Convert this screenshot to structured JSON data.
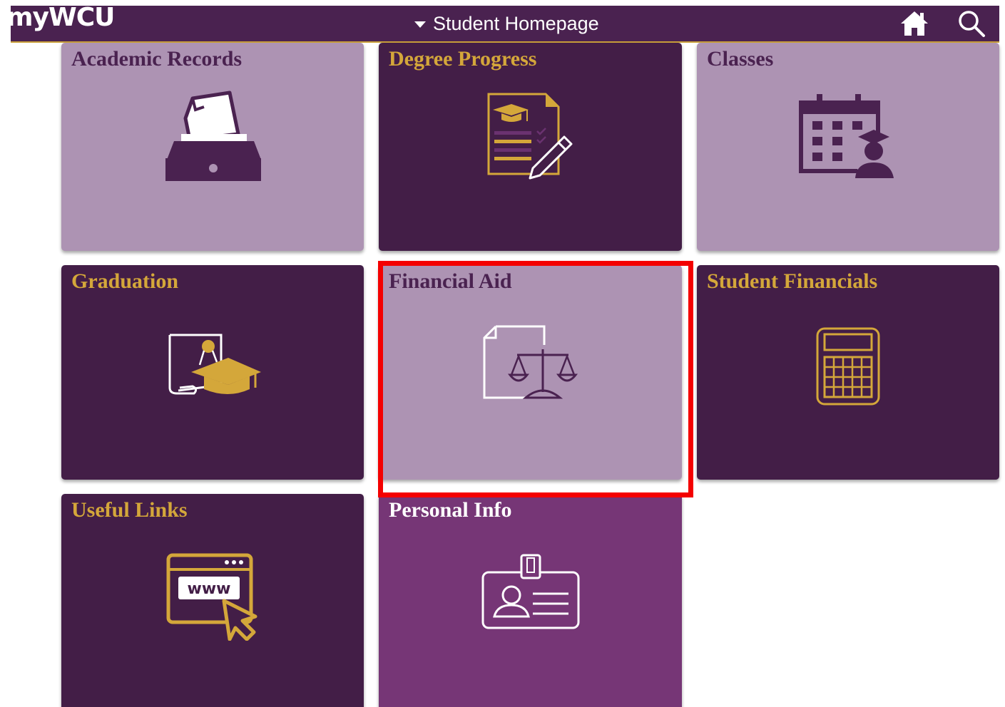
{
  "header": {
    "logo": "myWCU",
    "page_menu_label": "Student Homepage",
    "icons": {
      "caret": "caret-down-icon",
      "home": "home-icon",
      "search": "search-icon"
    }
  },
  "tiles": [
    {
      "title": "Academic Records",
      "icon": "file-drawer-icon",
      "theme": "light"
    },
    {
      "title": "Degree Progress",
      "icon": "degree-document-pencil-icon",
      "theme": "dark"
    },
    {
      "title": "Classes",
      "icon": "calendar-student-icon",
      "theme": "light"
    },
    {
      "title": "Graduation",
      "icon": "diploma-grad-cap-icon",
      "theme": "dark"
    },
    {
      "title": "Financial Aid",
      "icon": "document-scale-icon",
      "theme": "light",
      "highlighted": true
    },
    {
      "title": "Student Financials",
      "icon": "calculator-icon",
      "theme": "dark"
    },
    {
      "title": "Useful Links",
      "icon": "www-browser-cursor-icon",
      "theme": "dark"
    },
    {
      "title": "Personal Info",
      "icon": "id-badge-icon",
      "theme": "purple"
    }
  ],
  "colors": {
    "header_bg": "#4a2250",
    "tile_light": "#ad93b3",
    "tile_dark": "#431e47",
    "tile_purple": "#763676",
    "gold": "#d4a73a",
    "highlight": "#f40000"
  }
}
